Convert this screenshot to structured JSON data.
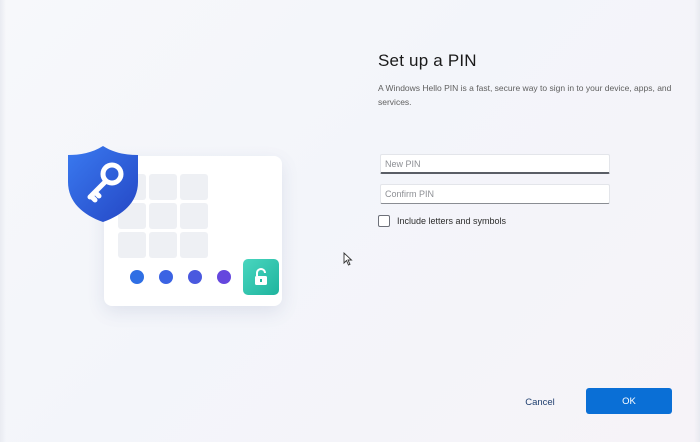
{
  "title": "Set up a PIN",
  "description": "A Windows Hello PIN is a fast, secure way to sign in to your device, apps, and services.",
  "fields": {
    "new_pin": {
      "placeholder": "New PIN",
      "value": ""
    },
    "confirm_pin": {
      "placeholder": "Confirm PIN",
      "value": ""
    }
  },
  "options": {
    "include_letters_label": "Include letters and symbols",
    "include_letters_checked": false
  },
  "buttons": {
    "cancel": "Cancel",
    "ok": "OK"
  },
  "icons": {
    "shield": "shield-key-icon",
    "unlock": "unlock-icon",
    "cursor": "mouse-cursor"
  },
  "colors": {
    "accent": "#0a6fd6",
    "shield": "#2f5bd6",
    "badge": "#2cc4ad"
  }
}
